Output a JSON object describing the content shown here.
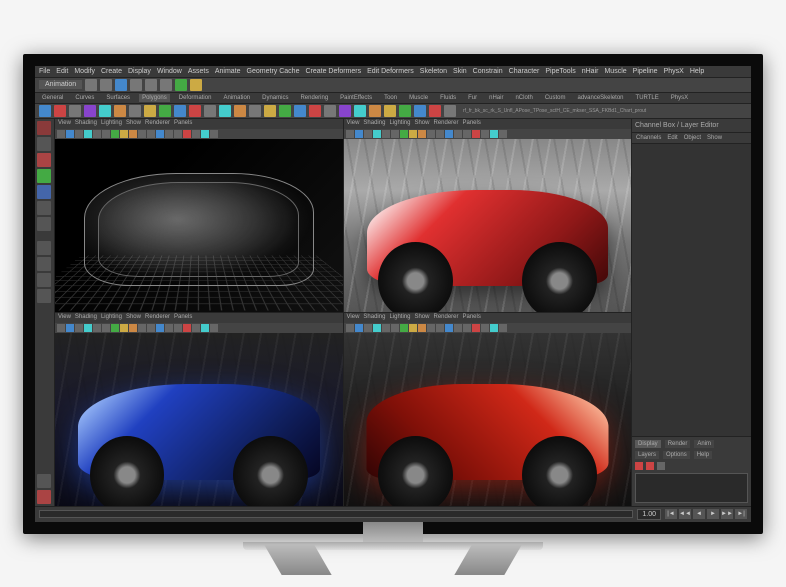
{
  "menubar": [
    "File",
    "Edit",
    "Modify",
    "Create",
    "Display",
    "Window",
    "Assets",
    "Animate",
    "Geometry Cache",
    "Create Deformers",
    "Edit Deformers",
    "Skeleton",
    "Skin",
    "Constrain",
    "Character",
    "PipeTools",
    "nHair",
    "Muscle",
    "Pipeline",
    "PhysX",
    "Help"
  ],
  "mode_dropdown": "Animation",
  "shelf_tabs": [
    "General",
    "Curves",
    "Surfaces",
    "Polygons",
    "Deformation",
    "Animation",
    "Dynamics",
    "Rendering",
    "PaintEffects",
    "Toon",
    "Muscle",
    "Fluids",
    "Fur",
    "nHair",
    "nCloth",
    "Custom",
    "advanceSkeleton",
    "TURTLE",
    "PhysX"
  ],
  "shelf_labels": "rf_fr_bk_sc_rk_S_Unfl_APose_TPose_sctH_CE_mkser_SSA_FKBd1_Chart_prout",
  "viewport_menu": [
    "View",
    "Shading",
    "Lighting",
    "Show",
    "Renderer",
    "Panels"
  ],
  "right_panel": {
    "header": "Channel Box / Layer Editor",
    "tabs": [
      "Channels",
      "Edit",
      "Object",
      "Show"
    ],
    "bottom_tabs_row1": [
      "Display",
      "Render",
      "Anim"
    ],
    "bottom_tabs_row2": [
      "Layers",
      "Options",
      "Help"
    ]
  },
  "time_value": "1.00",
  "playback": [
    "|◄",
    "◄◄",
    "◄",
    "►",
    "►►",
    "►|"
  ]
}
